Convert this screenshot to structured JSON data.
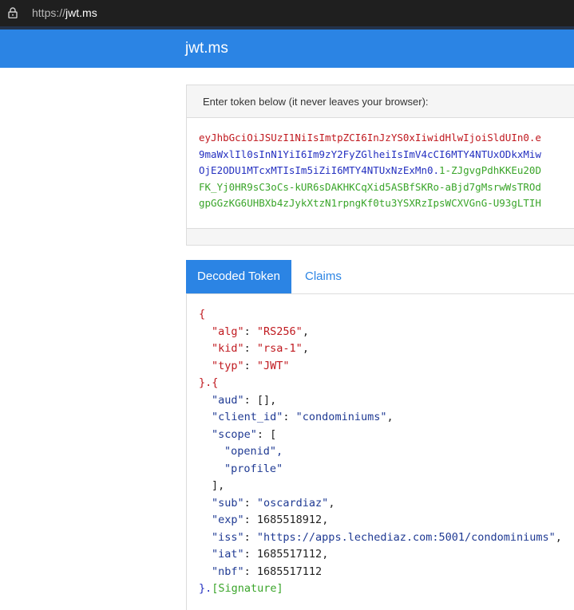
{
  "browser": {
    "url_scheme": "https://",
    "url_host": "jwt.ms"
  },
  "header": {
    "brand": "jwt.ms"
  },
  "token_panel": {
    "label": "Enter token below (it never leaves your browser):",
    "lines": [
      {
        "parts": [
          {
            "text": "eyJhbGciOiJSUzI1NiIsImtpZCI6InJzYS0xIiwidHlwIjoiSldUIn0.e",
            "color": "red"
          }
        ]
      },
      {
        "parts": [
          {
            "text": "9maWxlIl0sInN1YiI6Im9zY2FyZGlheiIsImV4cCI6MTY4NTUxODkxMiw",
            "color": "blue"
          }
        ]
      },
      {
        "parts": [
          {
            "text": "OjE2ODU1MTcxMTIsIm5iZiI6MTY4NTUxNzExMn0.",
            "color": "blue"
          },
          {
            "text": "1-ZJgvgPdhKKEu20D",
            "color": "green"
          }
        ]
      },
      {
        "parts": [
          {
            "text": "FK_Yj0HR9sC3oCs-kUR6sDAKHKCqXid5ASBfSKRo-aBjd7gMsrwWsTROd",
            "color": "green"
          }
        ]
      },
      {
        "parts": [
          {
            "text": "gpGGzKG6UHBXb4zJykXtzN1rpngKf0tu3YSXRzIpsWCXVGnG-U93gLTIH",
            "color": "green"
          }
        ]
      }
    ]
  },
  "tabs": {
    "decoded": "Decoded Token",
    "claims": "Claims"
  },
  "decoded": {
    "open_brace": "{",
    "header_close": "}.{",
    "footer_close": "}.",
    "signature": "[Signature]",
    "header_fields": [
      {
        "key": "\"alg\"",
        "value": "\"RS256\"",
        "trail": ","
      },
      {
        "key": "\"kid\"",
        "value": "\"rsa-1\"",
        "trail": ","
      },
      {
        "key": "\"typ\"",
        "value": "\"JWT\"",
        "trail": ""
      }
    ],
    "payload": {
      "aud_key": "\"aud\"",
      "aud_value": "[]",
      "client_id_key": "\"client_id\"",
      "client_id_value": "\"condominiums\"",
      "scope_key": "\"scope\"",
      "scope_open": "[",
      "scope_items": [
        "\"openid\",",
        "\"profile\""
      ],
      "scope_close": "],",
      "sub_key": "\"sub\"",
      "sub_value": "\"oscardiaz\"",
      "exp_key": "\"exp\"",
      "exp_value": "1685518912",
      "iss_key": "\"iss\"",
      "iss_value": "\"https://apps.lechediaz.com:5001/condominiums\"",
      "iat_key": "\"iat\"",
      "iat_value": "1685517112",
      "nbf_key": "\"nbf\"",
      "nbf_value": "1685517112"
    }
  },
  "colors": {
    "accent": "#2b84e4",
    "header_token_part": "#c0191f",
    "payload_token_part": "#2430c0",
    "signature_token_part": "#3aa52a"
  }
}
